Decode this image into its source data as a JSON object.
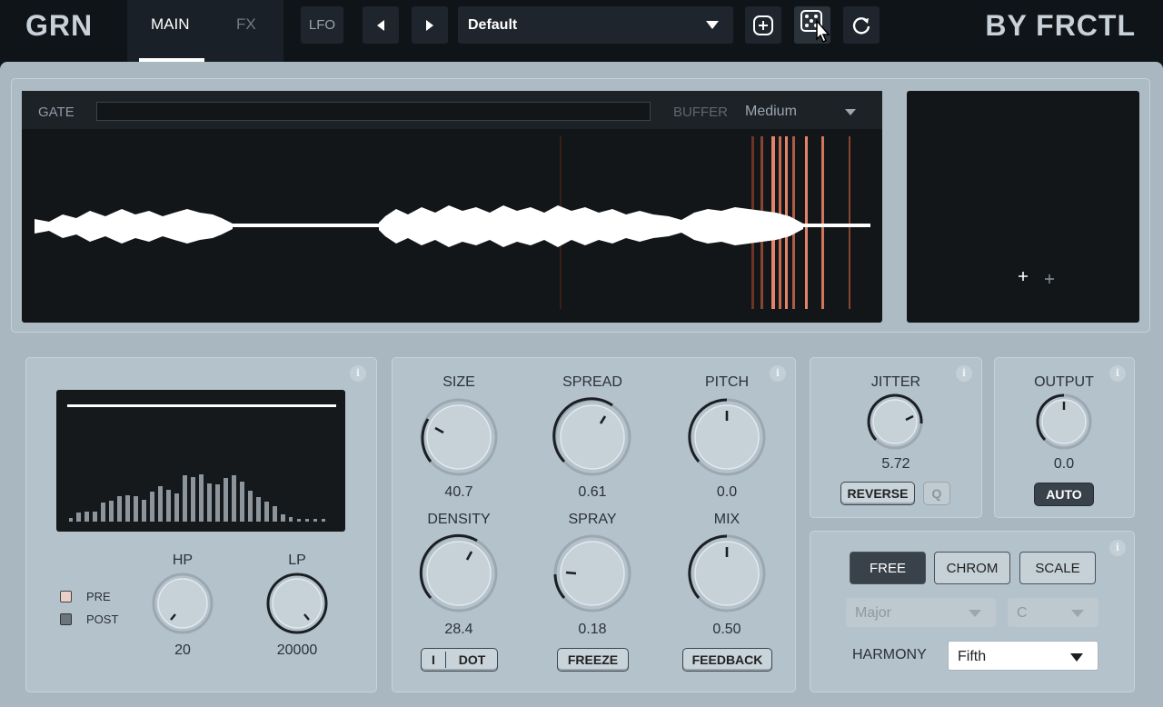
{
  "app": {
    "logo": "GRN",
    "brand": "BY FRCTL"
  },
  "tabs": [
    {
      "label": "MAIN"
    },
    {
      "label": "FX"
    }
  ],
  "toolbar": {
    "lfo_label": "LFO",
    "preset_name": "Default"
  },
  "waveform": {
    "gate_label": "GATE",
    "buffer_label": "BUFFER",
    "buffer_value": "Medium"
  },
  "filter": {
    "pre_label": "PRE",
    "post_label": "POST",
    "hp": {
      "label": "HP",
      "value": "20"
    },
    "lp": {
      "label": "LP",
      "value": "20000"
    }
  },
  "grain": {
    "size": {
      "label": "SIZE",
      "value": "40.7"
    },
    "spread": {
      "label": "SPREAD",
      "value": "0.61"
    },
    "pitch": {
      "label": "PITCH",
      "value": "0.0"
    },
    "density": {
      "label": "DENSITY",
      "value": "28.4"
    },
    "spray": {
      "label": "SPRAY",
      "value": "0.18"
    },
    "mix": {
      "label": "MIX",
      "value": "0.50"
    },
    "toggle_left": "I",
    "toggle_right": "DOT",
    "freeze_label": "FREEZE",
    "feedback_label": "FEEDBACK"
  },
  "jitter": {
    "label": "JITTER",
    "value": "5.72",
    "reverse_label": "REVERSE",
    "q_label": "Q"
  },
  "output": {
    "label": "OUTPUT",
    "value": "0.0",
    "auto_label": "AUTO"
  },
  "pitch_mode": {
    "free_label": "FREE",
    "chrom_label": "CHROM",
    "scale_label": "SCALE",
    "scale_value": "Major",
    "key_value": "C",
    "harmony_label": "HARMONY",
    "harmony_value": "Fifth"
  },
  "info_label": "i",
  "colors": {
    "accent_grain": "#e2836a",
    "panel": "#b4c2cc",
    "dark": "#121619"
  }
}
